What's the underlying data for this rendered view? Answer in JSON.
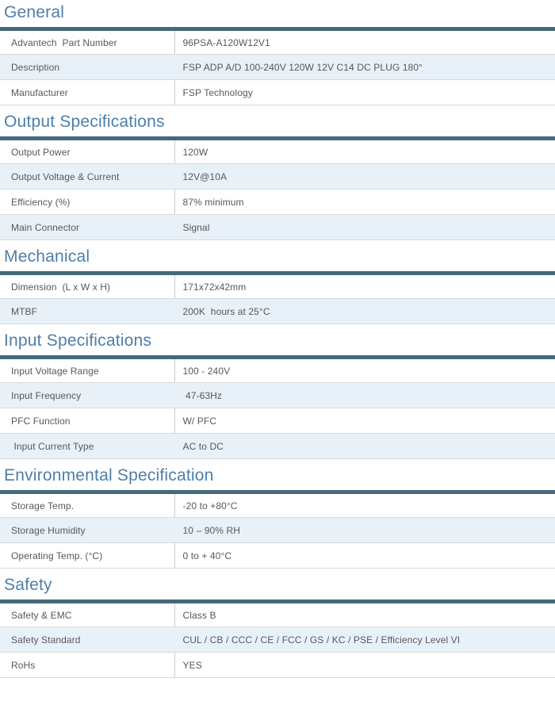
{
  "colors": {
    "heading": "#4d7fa9",
    "table_top_bar": "#45687c",
    "alt_row_background": "#e8f1f8",
    "row_border": "#d9d9d9",
    "column_divider": "#cccccc",
    "text": "#57585b"
  },
  "sections": [
    {
      "title": "General",
      "rows": [
        {
          "label": "Advantech  Part Number",
          "value": "96PSA-A120W12V1"
        },
        {
          "label": "Description",
          "value": "FSP ADP A/D 100-240V 120W 12V C14 DC PLUG 180°"
        },
        {
          "label": "Manufacturer",
          "value": "FSP Technology"
        }
      ]
    },
    {
      "title": "Output Specifications",
      "rows": [
        {
          "label": "Output Power",
          "value": "120W"
        },
        {
          "label": "Output Voltage & Current",
          "value": "12V@10A"
        },
        {
          "label": "Efficiency (%)",
          "value": "87% minimum"
        },
        {
          "label": "Main Connector",
          "value": "Signal"
        }
      ]
    },
    {
      "title": "Mechanical",
      "rows": [
        {
          "label": "Dimension  (L x W x H)",
          "value": "171x72x42mm"
        },
        {
          "label": "MTBF",
          "value": "200K  hours at 25°C"
        }
      ]
    },
    {
      "title": "Input Specifications",
      "rows": [
        {
          "label": "Input Voltage Range",
          "value": "100 - 240V"
        },
        {
          "label": "Input Frequency",
          "value": " 47-63Hz"
        },
        {
          "label": "PFC Function",
          "value": "W/ PFC"
        },
        {
          "label": " Input Current Type",
          "value": "AC to DC"
        }
      ]
    },
    {
      "title": "Environmental Specification",
      "rows": [
        {
          "label": "Storage Temp.",
          "value": "-20 to +80°C"
        },
        {
          "label": "Storage Humidity",
          "value": "10 – 90% RH"
        },
        {
          "label": "Operating Temp. (°C)",
          "value": "0 to + 40°C"
        }
      ]
    },
    {
      "title": "Safety",
      "rows": [
        {
          "label": "Safety & EMC",
          "value": "Class B"
        },
        {
          "label": "Safety Standard",
          "value": "CUL / CB / CCC / CE / FCC / GS / KC / PSE / Efficiency Level VI"
        },
        {
          "label": "RoHs",
          "value": "YES"
        }
      ]
    }
  ]
}
